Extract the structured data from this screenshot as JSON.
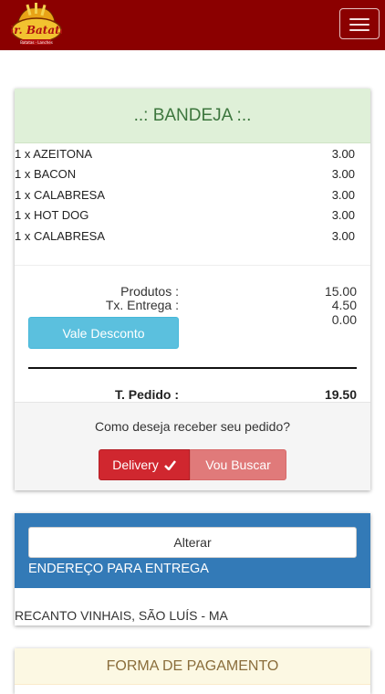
{
  "header": {
    "logo_text": "Sr. Batata",
    "logo_subtitle": "Batatas · Lanches",
    "menu_icon": "hamburger-menu-icon"
  },
  "order": {
    "title": "..: BANDEJA :..",
    "items": [
      {
        "desc": "1 x AZEITONA",
        "price": "3.00"
      },
      {
        "desc": "1 x BACON",
        "price": "3.00"
      },
      {
        "desc": "1 x CALABRESA",
        "price": "3.00"
      },
      {
        "desc": "1 x HOT DOG",
        "price": "3.00"
      },
      {
        "desc": "1 x CALABRESA",
        "price": "3.00"
      }
    ],
    "produtos_label": "Produtos :",
    "produtos_value": "15.00",
    "entrega_label": "Tx. Entrega :",
    "entrega_value": "4.50",
    "desconto_value": "0.00",
    "vale_desconto_label": "Vale Desconto",
    "total_label": "T. Pedido :",
    "total_value": "19.50",
    "receive_question": "Como deseja receber seu pedido?",
    "delivery_label": "Delivery",
    "buscar_label": "Vou Buscar",
    "delivery_icon": "check-icon"
  },
  "address": {
    "alterar_label": "Alterar",
    "title": "ENDEREÇO PARA ENTREGA",
    "text": "RECANTO VINHAIS, SÃO LUÍS - MA"
  },
  "payment": {
    "title": "FORMA DE PAGAMENTO"
  },
  "colors": {
    "topbar": "#8b0000",
    "order_head_bg": "#dff0d8",
    "order_head_text": "#3c763d",
    "vale_btn": "#5bc0de",
    "delivery_btn": "#d0272f",
    "buscar_btn": "#e07a7a",
    "address_head": "#337ab7",
    "payment_head_bg": "#fcf8e3",
    "payment_head_text": "#8a6d3b"
  }
}
